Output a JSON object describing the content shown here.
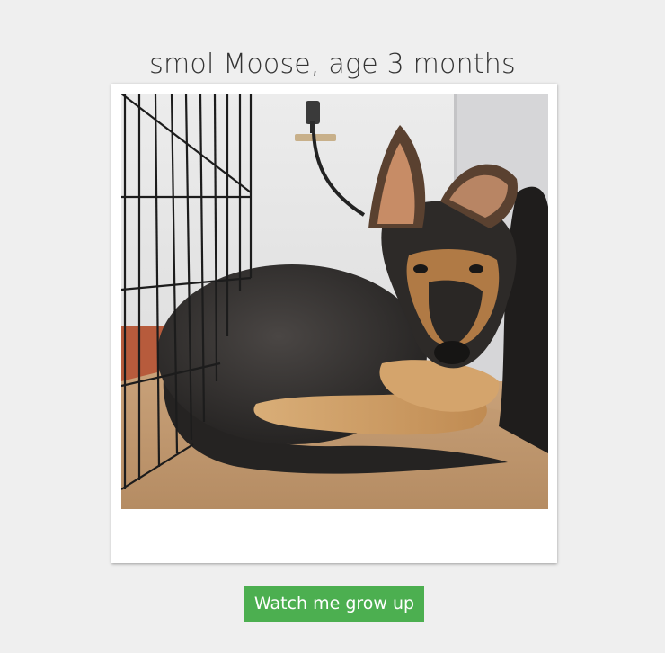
{
  "page": {
    "title": "smol Moose, age 3 months"
  },
  "photo": {
    "subject": "puppy-photo"
  },
  "actions": {
    "grow_button_label": "Watch me grow up"
  },
  "colors": {
    "background": "#efefef",
    "button": "#4caf50",
    "button_text": "#ffffff",
    "title": "#333333"
  }
}
